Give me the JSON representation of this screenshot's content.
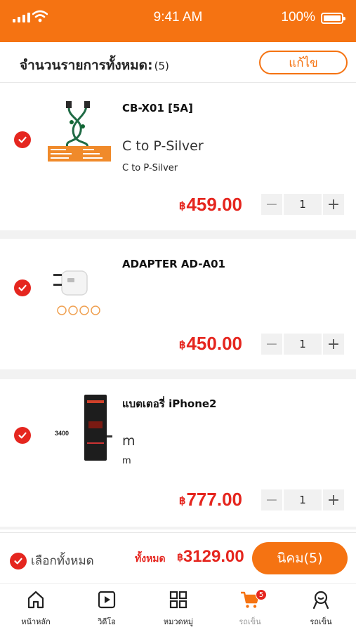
{
  "status_bar": {
    "time": "9:41 AM",
    "battery": "100%"
  },
  "header": {
    "title": "จำนวนรายการทั้งหมด:",
    "count": "(5)",
    "edit_label": "แก้ไข"
  },
  "cart": {
    "items": [
      {
        "name": "CB-X01 [5A]",
        "variant": "C to P-Silver",
        "variant_small": "C to P-Silver",
        "currency": "฿",
        "price": "459.00",
        "quantity": "1",
        "selected": true,
        "image": "cable-product-image"
      },
      {
        "name": "ADAPTER AD-A01",
        "variant": "",
        "variant_small": "",
        "currency": "฿",
        "price": "450.00",
        "quantity": "1",
        "selected": true,
        "image": "adapter-product-image"
      },
      {
        "name": "แบตเตอรี่ iPhone2",
        "variant": "m",
        "variant_small": "m",
        "currency": "฿",
        "price": "777.00",
        "quantity": "1",
        "selected": true,
        "image": "battery-product-image"
      }
    ],
    "qty_minus": "−",
    "qty_plus": "+"
  },
  "checkout": {
    "select_all_label": "เลือกทั้งหมด",
    "total_label": "ทั้งหมด",
    "currency": "฿",
    "total": "3129.00",
    "checkout_label": "นิคม(5)"
  },
  "battery_image_text": "3400",
  "tabs": [
    {
      "label": "หน้าหลัก",
      "icon": "home-icon"
    },
    {
      "label": "วิดีโอ",
      "icon": "video-icon"
    },
    {
      "label": "หมวดหมู่",
      "icon": "category-grid-icon"
    },
    {
      "label": "รถเข็น",
      "icon": "cart-icon",
      "badge": "5",
      "active": true
    },
    {
      "label": "รถเข็น",
      "icon": "profile-icon"
    }
  ],
  "colors": {
    "brand": "#f57312",
    "price": "#e5261f"
  }
}
